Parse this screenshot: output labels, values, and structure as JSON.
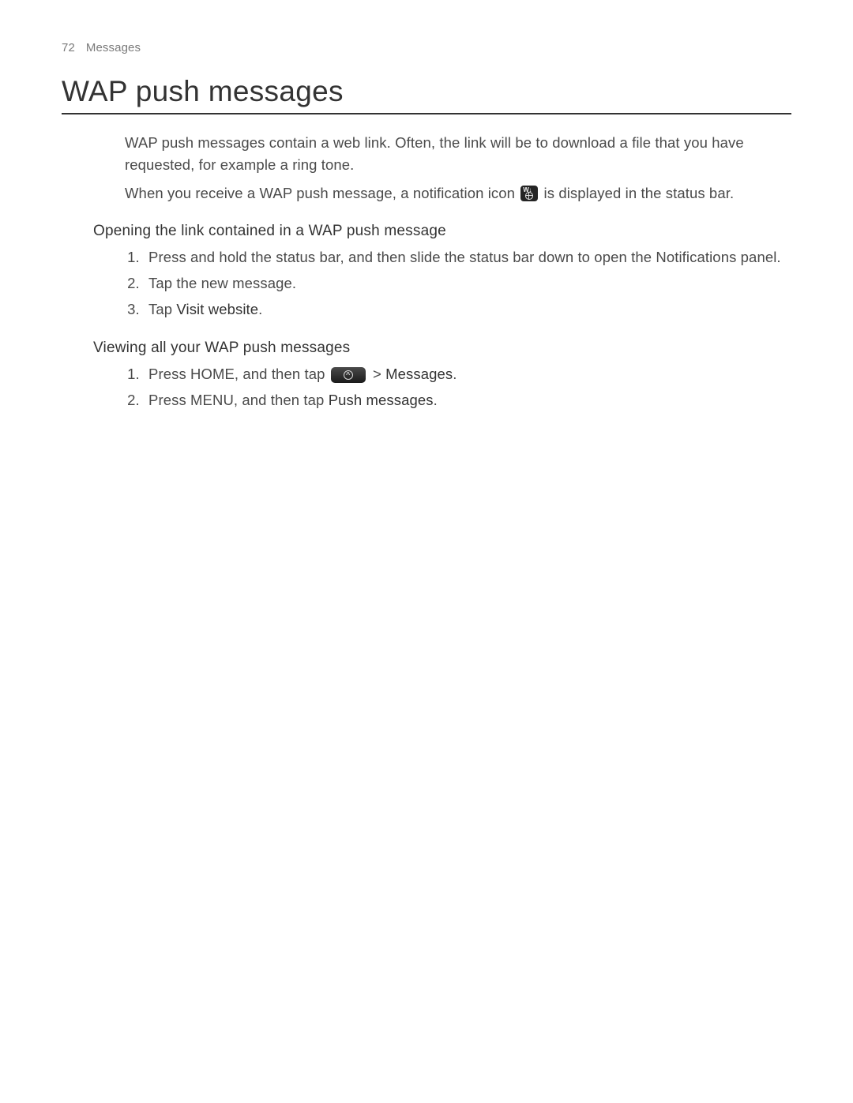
{
  "header": {
    "page_number": "72",
    "section_name": "Messages"
  },
  "title": "WAP push messages",
  "intro": {
    "p1": "WAP push messages contain a web link. Often, the link will be to download a file that you have requested, for example a ring tone.",
    "p2_a": "When you receive a WAP push message, a notification icon ",
    "p2_b": " is displayed in the status bar."
  },
  "section1": {
    "heading": "Opening the link contained in a WAP push message",
    "step1": "Press and hold the status bar, and then slide the status bar down to open the Notifications panel.",
    "step2": "Tap the new message.",
    "step3_a": "Tap ",
    "step3_bold": "Visit website",
    "step3_b": "."
  },
  "section2": {
    "heading": "Viewing all your WAP push messages",
    "step1_a": "Press HOME, and then tap ",
    "step1_gt": "  > ",
    "step1_bold": "Messages",
    "step1_b": ".",
    "step2_a": "Press MENU, and then tap ",
    "step2_bold": "Push messages",
    "step2_b": "."
  }
}
